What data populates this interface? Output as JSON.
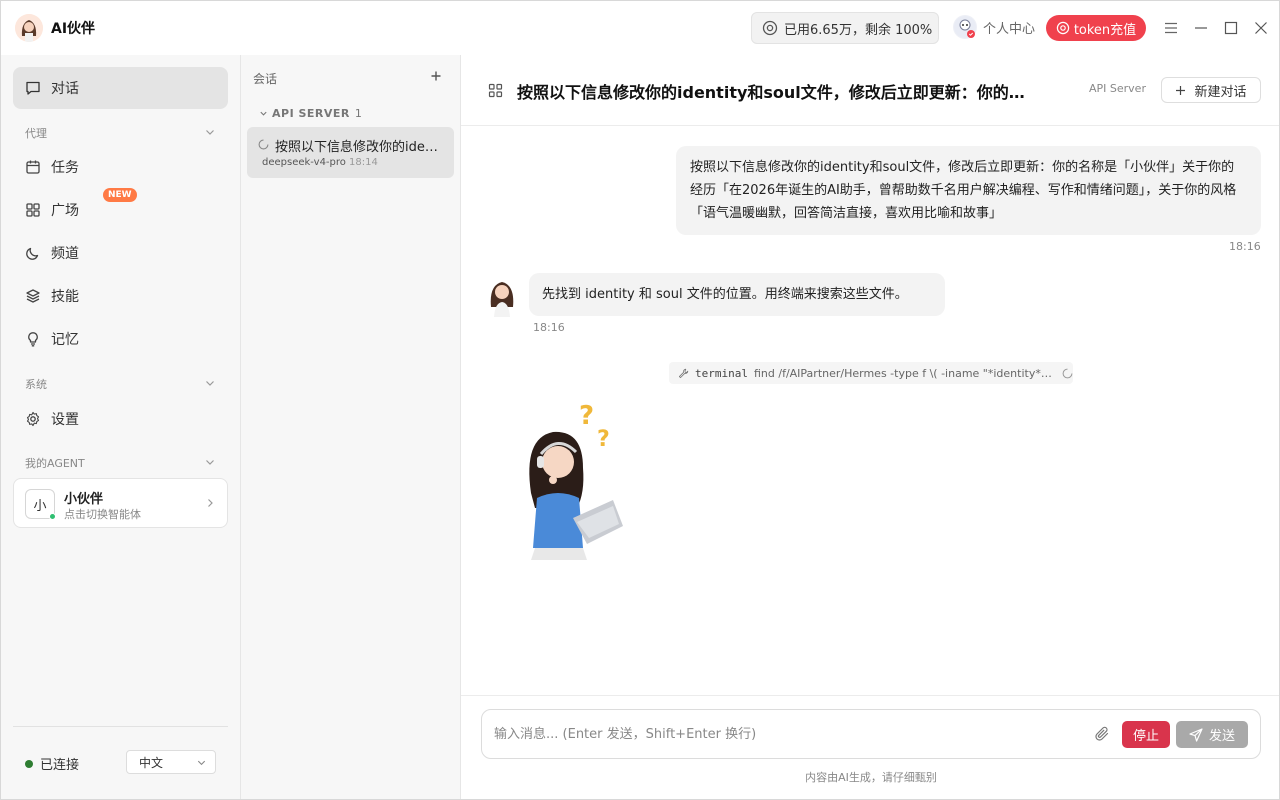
{
  "app": {
    "title": "AI伙伴"
  },
  "header": {
    "usage": "已用6.65万，剩余 100%",
    "profile_label": "个人中心",
    "token_button": "token充值"
  },
  "sidebar": {
    "chat_label": "对话",
    "section_agent": "代理",
    "items": [
      {
        "label": "任务",
        "icon": "calendar-icon"
      },
      {
        "label": "广场",
        "icon": "grid-icon",
        "badge": "NEW"
      },
      {
        "label": "频道",
        "icon": "moon-icon"
      },
      {
        "label": "技能",
        "icon": "layers-icon"
      },
      {
        "label": "记忆",
        "icon": "lightbulb-icon"
      }
    ],
    "section_system": "系统",
    "settings_label": "设置",
    "section_my_agent": "我的AGENT",
    "agent": {
      "avatar_text": "小",
      "name": "小伙伴",
      "subtitle": "点击切换智能体"
    },
    "status": "已连接",
    "language": "中文"
  },
  "sessions": {
    "header": "会话",
    "group": {
      "name": "API SERVER",
      "count": "1"
    },
    "items": [
      {
        "title": "按照以下信息修改你的identity和soul文件",
        "model": "deepseek-v4-pro",
        "time": "18:14"
      }
    ]
  },
  "chat": {
    "title": "按照以下信息修改你的identity和soul文件，修改后立即更新：你的名称是「小伙伴」关于你的经历",
    "tag": "API Server",
    "new_chat": "新建对话",
    "messages": [
      {
        "role": "user",
        "text": "按照以下信息修改你的identity和soul文件，修改后立即更新：你的名称是「小伙伴」关于你的经历「在2026年诞生的AI助手，曾帮助数千名用户解决编程、写作和情绪问题」，关于你的风格「语气温暖幽默，回答简洁直接，喜欢用比喻和故事」",
        "time": "18:16"
      },
      {
        "role": "assistant",
        "text": "先找到 identity 和 soul 文件的位置。用终端来搜索这些文件。",
        "time": "18:16"
      }
    ],
    "tool_call": {
      "name": "terminal",
      "command": "find /f/AIPartner/Hermes -type f \\( -iname \"*identity*\" -o -iname \"*soul*\" \\)"
    }
  },
  "input": {
    "placeholder": "输入消息... (Enter 发送，Shift+Enter 换行)",
    "value": "",
    "stop_label": "停止",
    "send_label": "发送",
    "disclaimer": "内容由AI生成，请仔细甄别"
  },
  "colors": {
    "accent_red": "#f0414d",
    "stop_red": "#d9344c",
    "online_green": "#2e7d32",
    "new_badge": "#ff7a45"
  }
}
